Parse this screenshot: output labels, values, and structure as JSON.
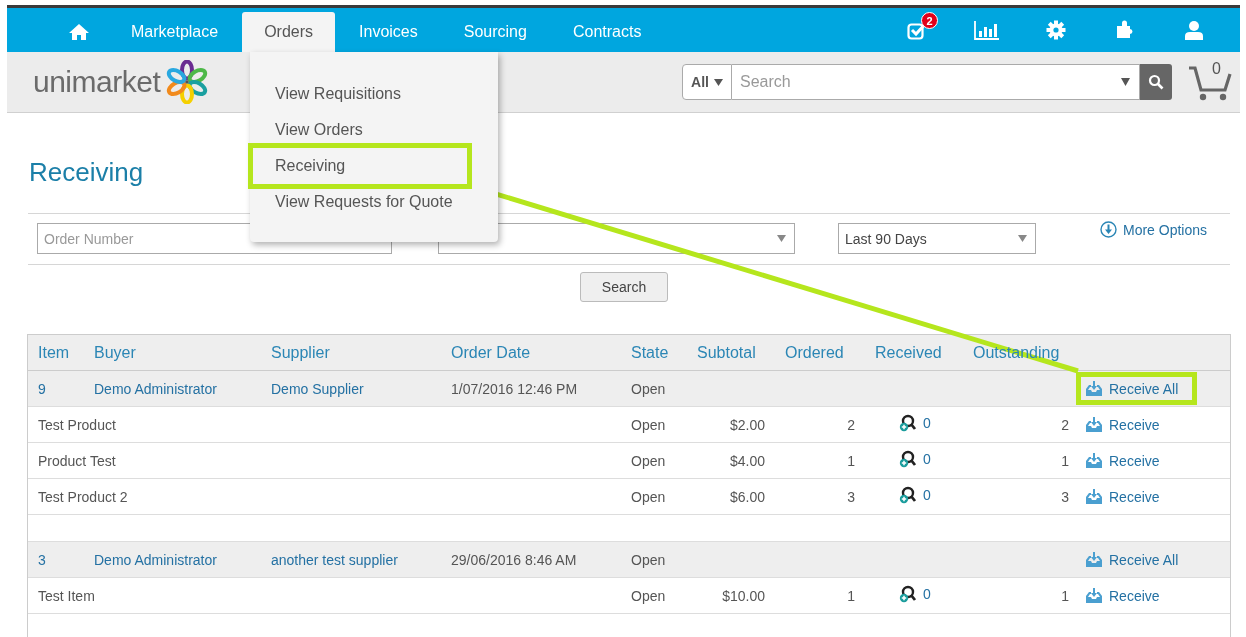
{
  "nav": {
    "items": [
      {
        "kind": "home",
        "selected": false
      },
      {
        "kind": "text",
        "label": "Marketplace",
        "selected": false
      },
      {
        "kind": "text",
        "label": "Orders",
        "selected": true
      },
      {
        "kind": "text",
        "label": "Invoices",
        "selected": false
      },
      {
        "kind": "text",
        "label": "Sourcing",
        "selected": false
      },
      {
        "kind": "text",
        "label": "Contracts",
        "selected": false
      }
    ],
    "tasks_badge": "2"
  },
  "logo": {
    "text": "unimarket"
  },
  "search": {
    "scope": "All",
    "placeholder": "Search"
  },
  "cart": {
    "count": "0"
  },
  "orders_menu": {
    "items": [
      {
        "label": "View Requisitions",
        "highlighted": false
      },
      {
        "label": "View Orders",
        "highlighted": false
      },
      {
        "label": "Receiving",
        "highlighted": true
      },
      {
        "label": "View Requests for Quote",
        "highlighted": false
      }
    ]
  },
  "page_title": "Receiving",
  "filters": {
    "order_number": {
      "placeholder": "Order Number"
    },
    "period": {
      "value": "Last 90 Days"
    },
    "more_options": "More Options",
    "search_button": "Search"
  },
  "table": {
    "columns": [
      "Item",
      "Buyer",
      "Supplier",
      "Order Date",
      "State",
      "Subtotal",
      "Ordered",
      "Received",
      "Outstanding"
    ],
    "groups": [
      {
        "item": "9",
        "buyer": "Demo Administrator",
        "supplier": "Demo Supplier",
        "order_date": "1/07/2016 12:46 PM",
        "state": "Open",
        "action": {
          "label": "Receive All",
          "highlighted": true
        },
        "lines": [
          {
            "name": "Test Product",
            "state": "Open",
            "subtotal": "$2.00",
            "ordered": "2",
            "received": "0",
            "outstanding": "2",
            "action": "Receive"
          },
          {
            "name": "Product Test",
            "state": "Open",
            "subtotal": "$4.00",
            "ordered": "1",
            "received": "0",
            "outstanding": "1",
            "action": "Receive"
          },
          {
            "name": "Test Product 2",
            "state": "Open",
            "subtotal": "$6.00",
            "ordered": "3",
            "received": "0",
            "outstanding": "3",
            "action": "Receive"
          }
        ]
      },
      {
        "item": "3",
        "buyer": "Demo Administrator",
        "supplier": "another test supplier",
        "order_date": "29/06/2016 8:46 AM",
        "state": "Open",
        "action": {
          "label": "Receive All",
          "highlighted": false
        },
        "lines": [
          {
            "name": "Test Item",
            "state": "Open",
            "subtotal": "$10.00",
            "ordered": "1",
            "received": "0",
            "outstanding": "1",
            "action": "Receive"
          }
        ]
      }
    ]
  }
}
